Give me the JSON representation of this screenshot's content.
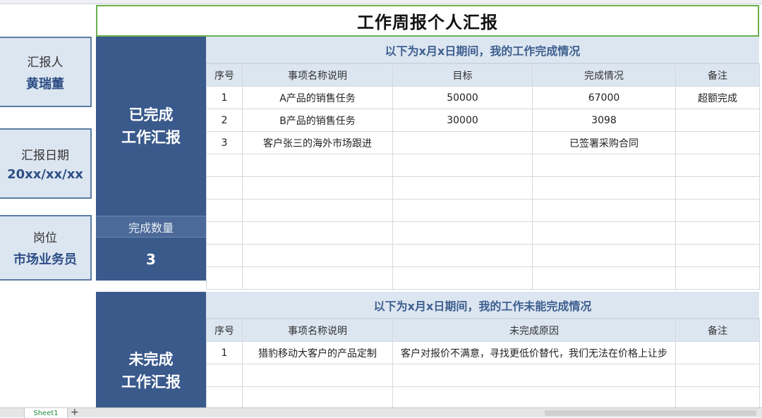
{
  "title": "工作周报个人汇报",
  "info": [
    {
      "label": "汇报人",
      "value": "黄瑞董"
    },
    {
      "label": "汇报日期",
      "value": "20xx/xx/xx"
    },
    {
      "label": "岗位",
      "value": "市场业务员"
    }
  ],
  "done": {
    "panel_line1": "已完成",
    "panel_line2": "工作汇报",
    "count_label": "完成数量",
    "count_value": "3",
    "header": "以下为x月x日期间，我的工作完成情况",
    "columns": [
      "序号",
      "事项名称说明",
      "目标",
      "完成情况",
      "备注"
    ],
    "rows": [
      [
        "1",
        "A产品的销售任务",
        "50000",
        "67000",
        "超额完成"
      ],
      [
        "2",
        "B产品的销售任务",
        "30000",
        "3098",
        ""
      ],
      [
        "3",
        "客户张三的海外市场跟进",
        "",
        "已签署采购合同",
        ""
      ]
    ]
  },
  "undone": {
    "panel_line1": "未完成",
    "panel_line2": "工作汇报",
    "header": "以下为x月x日期间，我的工作未能完成情况",
    "columns": [
      "序号",
      "事项名称说明",
      "未完成原因",
      "备注"
    ],
    "rows": [
      [
        "1",
        "猎豹移动大客户的产品定制",
        "客户对报价不满意，寻找更低价替代，我们无法在价格上让步",
        ""
      ]
    ]
  },
  "sheet_tab": "Sheet1",
  "add_sheet": "+"
}
